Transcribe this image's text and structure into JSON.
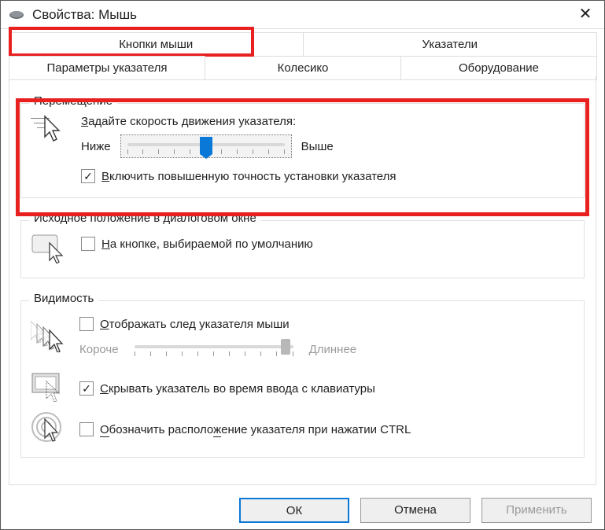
{
  "window": {
    "title": "Свойства: Мышь"
  },
  "tabs": {
    "row1": [
      "Кнопки мыши",
      "Указатели"
    ],
    "row2": [
      "Параметры указателя",
      "Колесико",
      "Оборудование"
    ],
    "active": "Параметры указателя"
  },
  "sections": {
    "movement": {
      "legend": "Перемещение",
      "speed_label": "Задайте скорость движения указателя:",
      "slider_low": "Ниже",
      "slider_high": "Выше",
      "slider_value": 50,
      "precision_label": "Включить повышенную точность установки указателя",
      "precision_checked": true
    },
    "snap": {
      "legend": "Исходное положение в диалоговом окне",
      "label": "На кнопке, выбираемой по умолчанию",
      "checked": false
    },
    "visibility": {
      "legend": "Видимость",
      "trail_label": "Отображать след указателя мыши",
      "trail_checked": false,
      "trail_low": "Короче",
      "trail_high": "Длиннее",
      "trail_value": 92,
      "hide_label": "Скрывать указатель во время ввода с клавиатуры",
      "hide_checked": true,
      "locate_label": "Обозначить расположение указателя при нажатии CTRL",
      "locate_checked": false
    }
  },
  "buttons": {
    "ok": "ОК",
    "cancel": "Отмена",
    "apply": "Применить"
  }
}
